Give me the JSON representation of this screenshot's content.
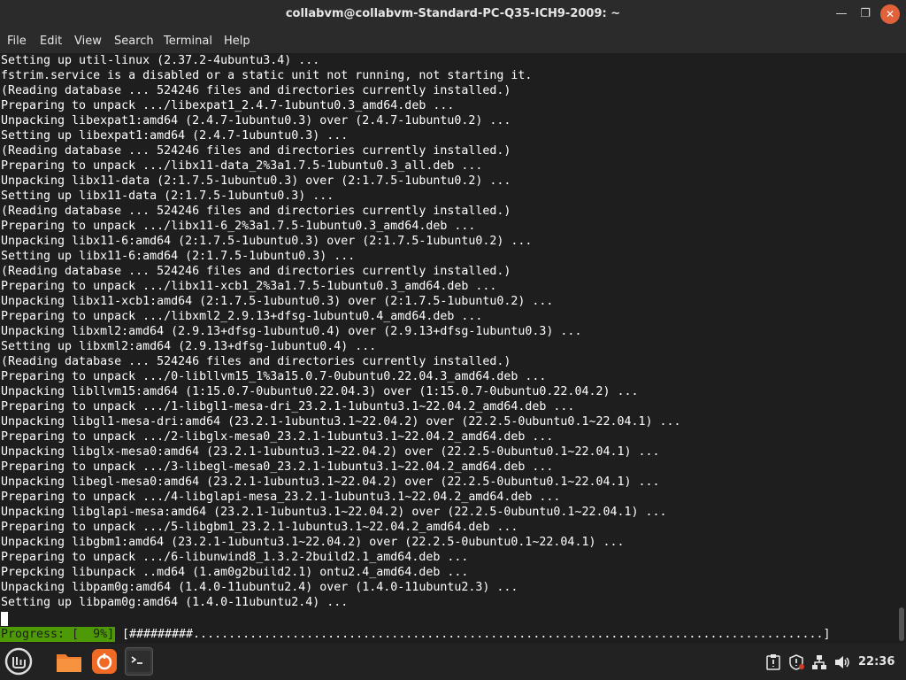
{
  "window": {
    "title": "collabvm@collabvm-Standard-PC-Q35-ICH9-2009: ~",
    "minimize_glyph": "—",
    "maximize_glyph": "❐",
    "close_glyph": "✕"
  },
  "menu": [
    "File",
    "Edit",
    "View",
    "Search",
    "Terminal",
    "Help"
  ],
  "terminal": {
    "lines": [
      "Setting up util-linux (2.37.2-4ubuntu3.4) ...",
      "fstrim.service is a disabled or a static unit not running, not starting it.",
      "(Reading database ... 524246 files and directories currently installed.)",
      "Preparing to unpack .../libexpat1_2.4.7-1ubuntu0.3_amd64.deb ...",
      "Unpacking libexpat1:amd64 (2.4.7-1ubuntu0.3) over (2.4.7-1ubuntu0.2) ...",
      "Setting up libexpat1:amd64 (2.4.7-1ubuntu0.3) ...",
      "(Reading database ... 524246 files and directories currently installed.)",
      "Preparing to unpack .../libx11-data_2%3a1.7.5-1ubuntu0.3_all.deb ...",
      "Unpacking libx11-data (2:1.7.5-1ubuntu0.3) over (2:1.7.5-1ubuntu0.2) ...",
      "Setting up libx11-data (2:1.7.5-1ubuntu0.3) ...",
      "(Reading database ... 524246 files and directories currently installed.)",
      "Preparing to unpack .../libx11-6_2%3a1.7.5-1ubuntu0.3_amd64.deb ...",
      "Unpacking libx11-6:amd64 (2:1.7.5-1ubuntu0.3) over (2:1.7.5-1ubuntu0.2) ...",
      "Setting up libx11-6:amd64 (2:1.7.5-1ubuntu0.3) ...",
      "(Reading database ... 524246 files and directories currently installed.)",
      "Preparing to unpack .../libx11-xcb1_2%3a1.7.5-1ubuntu0.3_amd64.deb ...",
      "Unpacking libx11-xcb1:amd64 (2:1.7.5-1ubuntu0.3) over (2:1.7.5-1ubuntu0.2) ...",
      "Preparing to unpack .../libxml2_2.9.13+dfsg-1ubuntu0.4_amd64.deb ...",
      "Unpacking libxml2:amd64 (2.9.13+dfsg-1ubuntu0.4) over (2.9.13+dfsg-1ubuntu0.3) ...",
      "Setting up libxml2:amd64 (2.9.13+dfsg-1ubuntu0.4) ...",
      "(Reading database ... 524246 files and directories currently installed.)",
      "Preparing to unpack .../0-libllvm15_1%3a15.0.7-0ubuntu0.22.04.3_amd64.deb ...",
      "Unpacking libllvm15:amd64 (1:15.0.7-0ubuntu0.22.04.3) over (1:15.0.7-0ubuntu0.22.04.2) ...",
      "Preparing to unpack .../1-libgl1-mesa-dri_23.2.1-1ubuntu3.1~22.04.2_amd64.deb ...",
      "Unpacking libgl1-mesa-dri:amd64 (23.2.1-1ubuntu3.1~22.04.2) over (22.2.5-0ubuntu0.1~22.04.1) ...",
      "Preparing to unpack .../2-libglx-mesa0_23.2.1-1ubuntu3.1~22.04.2_amd64.deb ...",
      "Unpacking libglx-mesa0:amd64 (23.2.1-1ubuntu3.1~22.04.2) over (22.2.5-0ubuntu0.1~22.04.1) ...",
      "Preparing to unpack .../3-libegl-mesa0_23.2.1-1ubuntu3.1~22.04.2_amd64.deb ...",
      "Unpacking libegl-mesa0:amd64 (23.2.1-1ubuntu3.1~22.04.2) over (22.2.5-0ubuntu0.1~22.04.1) ...",
      "Preparing to unpack .../4-libglapi-mesa_23.2.1-1ubuntu3.1~22.04.2_amd64.deb ...",
      "Unpacking libglapi-mesa:amd64 (23.2.1-1ubuntu3.1~22.04.2) over (22.2.5-0ubuntu0.1~22.04.1) ...",
      "Preparing to unpack .../5-libgbm1_23.2.1-1ubuntu3.1~22.04.2_amd64.deb ...",
      "Unpacking libgbm1:amd64 (23.2.1-1ubuntu3.1~22.04.2) over (22.2.5-0ubuntu0.1~22.04.1) ...",
      "Preparing to unpack .../6-libunwind8_1.3.2-2build2.1_amd64.deb ...",
      "Prepcking libunpack ..md64 (1.am0g2build2.1) ontu2.4_amd64.deb ...",
      "Unpacking libpam0g:amd64 (1.4.0-11ubuntu2.4) over (1.4.0-11ubuntu2.3) ...",
      "Setting up libpam0g:amd64 (1.4.0-11ubuntu2.4) ..."
    ],
    "progress_label": "Progress: [  9%]",
    "progress_bar": "[#########.........................................................................................]",
    "progress_percent": 9
  },
  "taskbar": {
    "clock": "22:36",
    "colors": {
      "mint": "#5a5a5a",
      "files": "#f07d2c",
      "update": "#f06a26",
      "terminal": "#333333"
    }
  }
}
